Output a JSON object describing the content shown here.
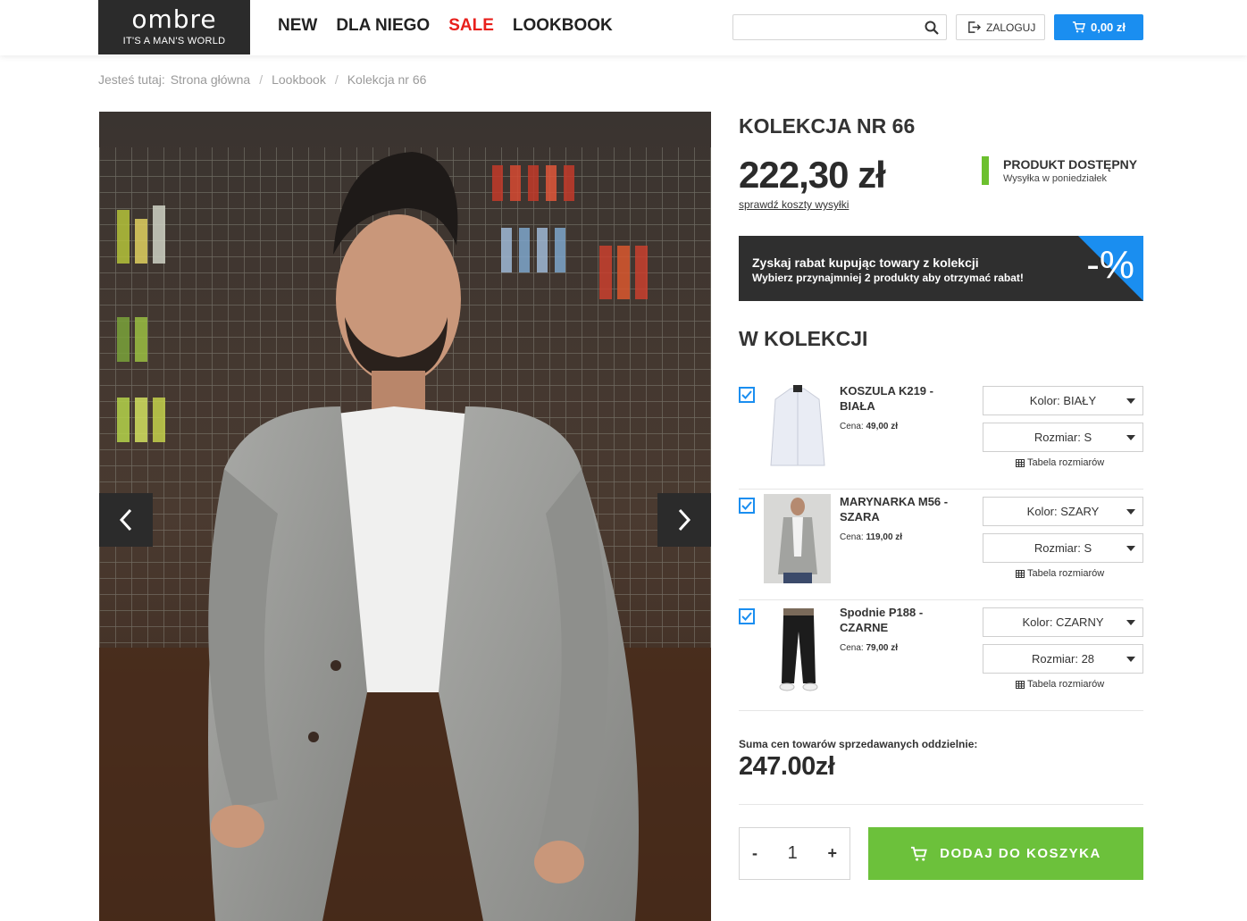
{
  "header": {
    "logo_brand": "ombre",
    "logo_tagline": "IT'S A MAN'S WORLD",
    "nav": [
      {
        "label": "NEW"
      },
      {
        "label": "DLA NIEGO"
      },
      {
        "label": "SALE"
      },
      {
        "label": "LOOKBOOK"
      }
    ],
    "search_placeholder": "",
    "login_label": "ZALOGUJ",
    "cart_label": "0,00 zł"
  },
  "breadcrumb": {
    "prefix": "Jesteś tutaj:",
    "items": [
      "Strona główna",
      "Lookbook",
      "Kolekcja nr 66"
    ]
  },
  "product": {
    "title": "KOLEKCJA NR 66",
    "price": "222,30 zł",
    "shipping_link": "sprawdź koszty wysyłki",
    "availability_title": "PRODUKT DOSTĘPNY",
    "availability_sub": "Wysyłka w poniedziałek"
  },
  "promo": {
    "line1": "Zyskaj rabat kupując towary z kolekcji",
    "line2": "Wybierz przynajmniej 2 produkty aby otrzymać rabat!",
    "badge": "-%"
  },
  "collection": {
    "heading": "W KOLEKCJI",
    "items": [
      {
        "name": "KOSZULA K219 - BIAŁA",
        "price_label": "Cena:",
        "price": "49,00 zł",
        "color": "Kolor: BIAŁY",
        "size": "Rozmiar: S",
        "size_table": "Tabela rozmiarów",
        "checked": true
      },
      {
        "name": "MARYNARKA M56 - SZARA",
        "price_label": "Cena:",
        "price": "119,00 zł",
        "color": "Kolor: SZARY",
        "size": "Rozmiar: S",
        "size_table": "Tabela rozmiarów",
        "checked": true
      },
      {
        "name": "Spodnie P188 - CZARNE",
        "price_label": "Cena:",
        "price": "79,00 zł",
        "color": "Kolor: CZARNY",
        "size": "Rozmiar: 28",
        "size_table": "Tabela rozmiarów",
        "checked": true
      }
    ]
  },
  "summary": {
    "label": "Suma cen towarów sprzedawanych oddzielnie:",
    "value": "247.00zł"
  },
  "purchase": {
    "minus": "-",
    "qty": "1",
    "plus": "+",
    "add_label": "DODAJ DO KOSZYKA"
  },
  "colors": {
    "accent_blue": "#1a8ef0",
    "green": "#6cc13b",
    "sale_red": "#e8201c",
    "dark": "#2b2b2b"
  }
}
